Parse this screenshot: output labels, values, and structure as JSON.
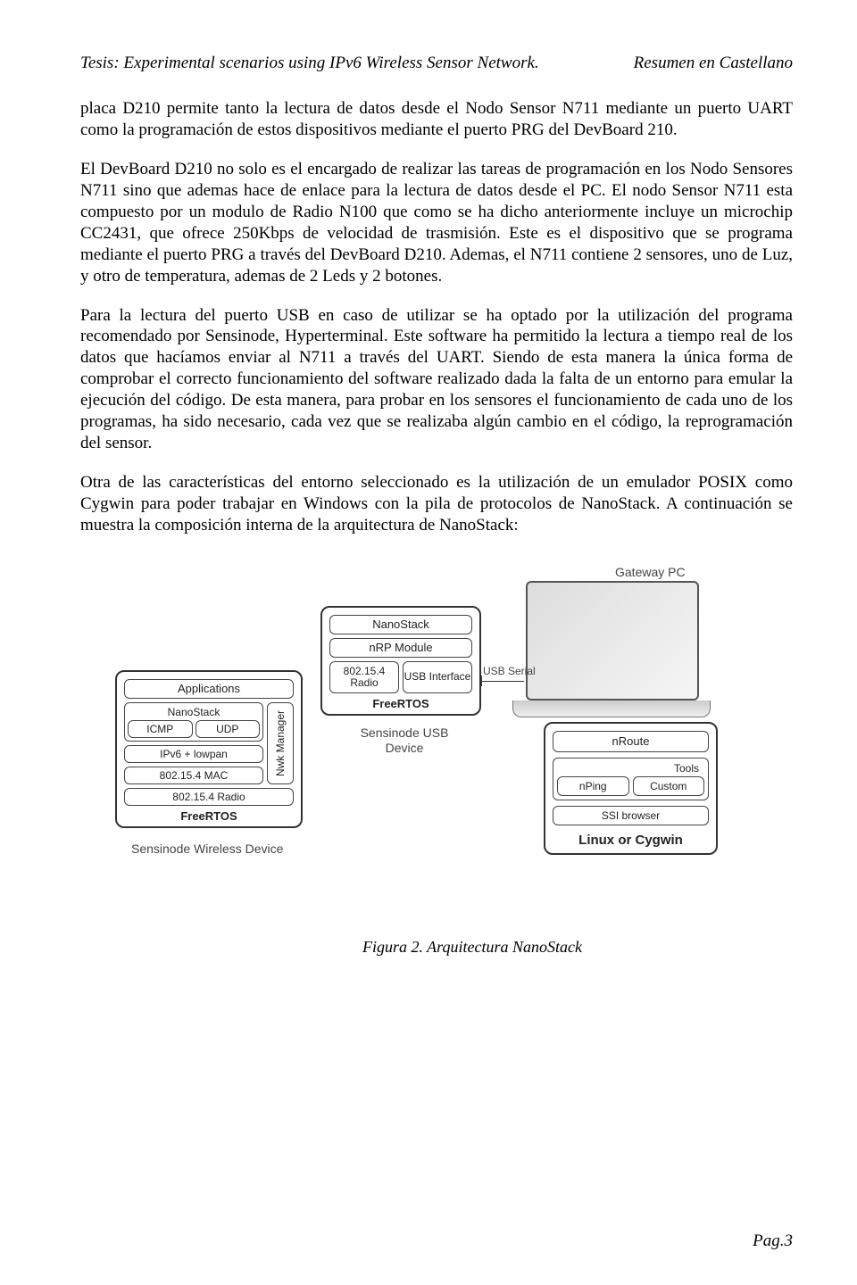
{
  "header": {
    "left": "Tesis: Experimental scenarios using IPv6 Wireless Sensor Network.",
    "right": "Resumen en Castellano"
  },
  "paragraphs": {
    "p1": "placa D210 permite tanto la lectura de datos desde el Nodo Sensor N711 mediante un puerto UART como la programación de estos dispositivos mediante el puerto PRG del DevBoard 210.",
    "p2": "El DevBoard D210 no solo es el encargado de realizar las tareas de programación en los Nodo Sensores N711 sino que ademas hace de enlace para la lectura de datos desde el PC. El nodo Sensor N711 esta compuesto por un modulo de Radio N100 que como se ha dicho anteriormente incluye un microchip CC2431, que ofrece 250Kbps de velocidad de trasmisión. Este es el dispositivo que se programa mediante el puerto PRG a través del DevBoard D210. Ademas, el N711 contiene 2 sensores, uno de Luz, y otro de temperatura, ademas de 2 Leds y 2 botones.",
    "p3": "Para la lectura del puerto USB en caso de utilizar se ha optado por la utilización del programa recomendado por Sensinode, Hyperterminal. Este software ha permitido la lectura a tiempo real de los datos que hacíamos enviar al N711 a través del UART. Siendo de esta manera la única forma de comprobar el correcto funcionamiento del software realizado dada la falta de un entorno para emular la ejecución del código. De esta manera, para probar en los sensores el funcionamiento de cada uno de los programas, ha sido necesario, cada vez que se realizaba algún cambio en el código, la reprogramación del sensor.",
    "p4": "Otra de las características del entorno seleccionado es la utilización de un emulador POSIX como Cygwin para poder trabajar en Windows con la pila de protocolos de NanoStack. A continuación se muestra la composición interna de la arquitectura de NanoStack:"
  },
  "figure": {
    "gateway_label": "Gateway PC",
    "usb_label": "USB Serial",
    "wireless": {
      "title": "Sensinode Wireless Device",
      "apps": "Applications",
      "nano": "NanoStack",
      "icmp": "ICMP",
      "udp": "UDP",
      "ipv6": "IPv6 + lowpan",
      "mac": "802.15.4 MAC",
      "radio": "802.15.4 Radio",
      "nwk": "Nwk Manager",
      "rtos": "FreeRTOS"
    },
    "usbdev": {
      "title": "Sensinode USB Device",
      "nano": "NanoStack",
      "nrp": "nRP Module",
      "radio": "802.15.4 Radio",
      "usb": "USB Interface",
      "rtos": "FreeRTOS"
    },
    "pc": {
      "nroute": "nRoute",
      "tools": "Tools",
      "nping": "nPing",
      "custom": "Custom",
      "ssi": "SSI browser",
      "os": "Linux or Cygwin"
    }
  },
  "caption": "Figura 2. Arquitectura NanoStack",
  "footer": "Pag.3"
}
